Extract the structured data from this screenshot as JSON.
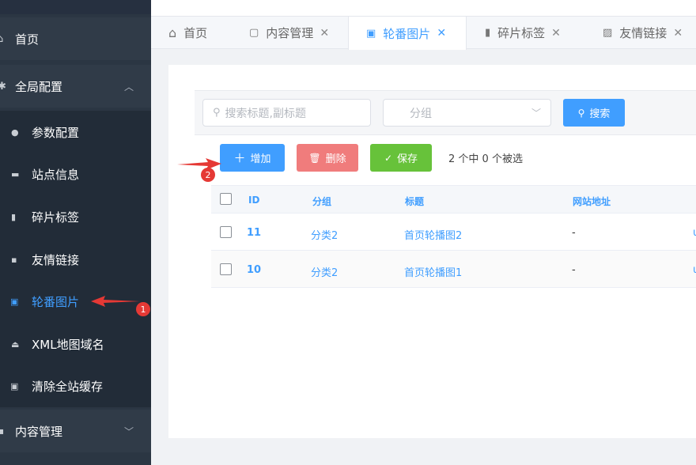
{
  "sidebar": {
    "items": [
      {
        "label": "首页",
        "icon": "home-icon"
      },
      {
        "label": "全局配置",
        "icon": "gear-icon"
      },
      {
        "label": "参数配置",
        "icon": "settings-dot-icon"
      },
      {
        "label": "站点信息",
        "icon": "monitor-icon"
      },
      {
        "label": "碎片标签",
        "icon": "bookmark-icon"
      },
      {
        "label": "友情链接",
        "icon": "link-box-icon"
      },
      {
        "label": "轮番图片",
        "icon": "image-icon"
      },
      {
        "label": "XML地图域名",
        "icon": "user-icon"
      },
      {
        "label": "清除全站缓存",
        "icon": "image-icon"
      },
      {
        "label": "内容管理",
        "icon": "grid-icon"
      }
    ]
  },
  "tabs": [
    {
      "label": "首页"
    },
    {
      "label": "内容管理"
    },
    {
      "label": "轮番图片"
    },
    {
      "label": "碎片标签"
    },
    {
      "label": "友情链接"
    }
  ],
  "search": {
    "keyword_placeholder": "搜索标题,副标题",
    "group_placeholder": "分组",
    "search_label": "搜索"
  },
  "toolbar": {
    "add_label": "增加",
    "delete_label": "删除",
    "save_label": "保存",
    "selection_text": "2 个中 0 个被选"
  },
  "table": {
    "columns": [
      "ID",
      "分组",
      "标题",
      "网站地址"
    ],
    "rows": [
      {
        "id": "11",
        "group": "分类2",
        "title": "首页轮播图2",
        "url": "-",
        "extra": "u"
      },
      {
        "id": "10",
        "group": "分类2",
        "title": "首页轮播图1",
        "url": "-",
        "extra": "u"
      }
    ]
  },
  "annotations": {
    "badge1": "1",
    "badge2": "2"
  },
  "colors": {
    "sidebar_bg": "#2b3643",
    "accent": "#409eff",
    "danger": "#f56c6c",
    "success": "#67c23a",
    "annotation_red": "#e53935"
  }
}
